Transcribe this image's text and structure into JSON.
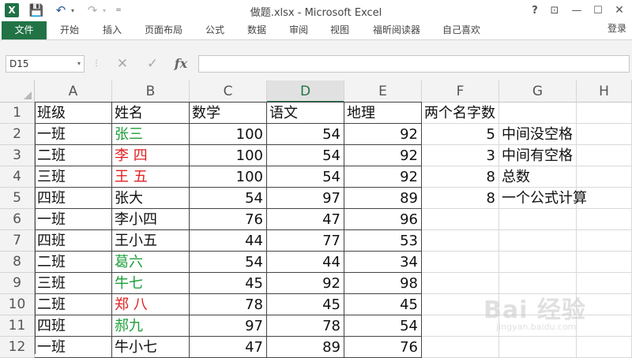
{
  "window": {
    "title": "做题.xlsx - Microsoft Excel",
    "help": "?",
    "restore_ribbon": "⊡",
    "minimize": "—",
    "maximize": "☐",
    "close": "✕"
  },
  "qat": {
    "app_logo": "X",
    "save_icon": "💾",
    "undo_icon": "↶",
    "redo_icon": "↷",
    "dropdown": "▾",
    "more": "="
  },
  "ribbon": {
    "tabs": [
      "文件",
      "开始",
      "插入",
      "页面布局",
      "公式",
      "数据",
      "审阅",
      "视图",
      "福昕阅读器",
      "自己喜欢"
    ],
    "signin": "登录"
  },
  "formula_bar": {
    "name_box": "D15",
    "name_box_arrow": "▾",
    "separator": "⋮",
    "cancel": "✕",
    "enter": "✓",
    "fx": "fx",
    "formula": ""
  },
  "sheet": {
    "columns": [
      "A",
      "B",
      "C",
      "D",
      "E",
      "F",
      "G",
      "H"
    ],
    "selected_column": "D",
    "rows": [
      {
        "n": "1",
        "A": "班级",
        "B": "姓名",
        "C": "数学",
        "D": "语文",
        "E": "地理",
        "F": "两个名字数",
        "G": ""
      },
      {
        "n": "2",
        "A": "一班",
        "B": "张三",
        "B_color": "green",
        "C": "100",
        "D": "54",
        "E": "92",
        "F": "5",
        "G": "中间没空格"
      },
      {
        "n": "3",
        "A": "二班",
        "B": "李  四",
        "B_color": "red",
        "C": "100",
        "D": "54",
        "E": "92",
        "F": "3",
        "G": "中间有空格"
      },
      {
        "n": "4",
        "A": "三班",
        "B": "王  五",
        "B_color": "red",
        "C": "100",
        "D": "54",
        "E": "92",
        "F": "8",
        "G": "总数"
      },
      {
        "n": "5",
        "A": "四班",
        "B": "张大",
        "C": "54",
        "D": "97",
        "E": "89",
        "F": "8",
        "G": "一个公式计算"
      },
      {
        "n": "6",
        "A": "一班",
        "B": "李小四",
        "C": "76",
        "D": "47",
        "E": "96",
        "F": "",
        "G": ""
      },
      {
        "n": "7",
        "A": "四班",
        "B": "王小五",
        "C": "44",
        "D": "77",
        "E": "53",
        "F": "",
        "G": ""
      },
      {
        "n": "8",
        "A": "二班",
        "B": "葛六",
        "B_color": "green",
        "C": "54",
        "D": "44",
        "E": "34",
        "F": "",
        "G": ""
      },
      {
        "n": "9",
        "A": "三班",
        "B": "牛七",
        "B_color": "green",
        "C": "45",
        "D": "92",
        "E": "98",
        "F": "",
        "G": ""
      },
      {
        "n": "10",
        "A": "二班",
        "B": "郑  八",
        "B_color": "red",
        "C": "78",
        "D": "45",
        "E": "45",
        "F": "",
        "G": ""
      },
      {
        "n": "11",
        "A": "四班",
        "B": "郝九",
        "B_color": "green",
        "C": "97",
        "D": "78",
        "E": "54",
        "F": "",
        "G": ""
      },
      {
        "n": "12",
        "A": "一班",
        "B": "牛小七",
        "C": "47",
        "D": "89",
        "E": "76",
        "F": "",
        "G": ""
      }
    ]
  },
  "watermark": {
    "text": "Bai 经验",
    "sub": "jingyan.baidu.com"
  }
}
